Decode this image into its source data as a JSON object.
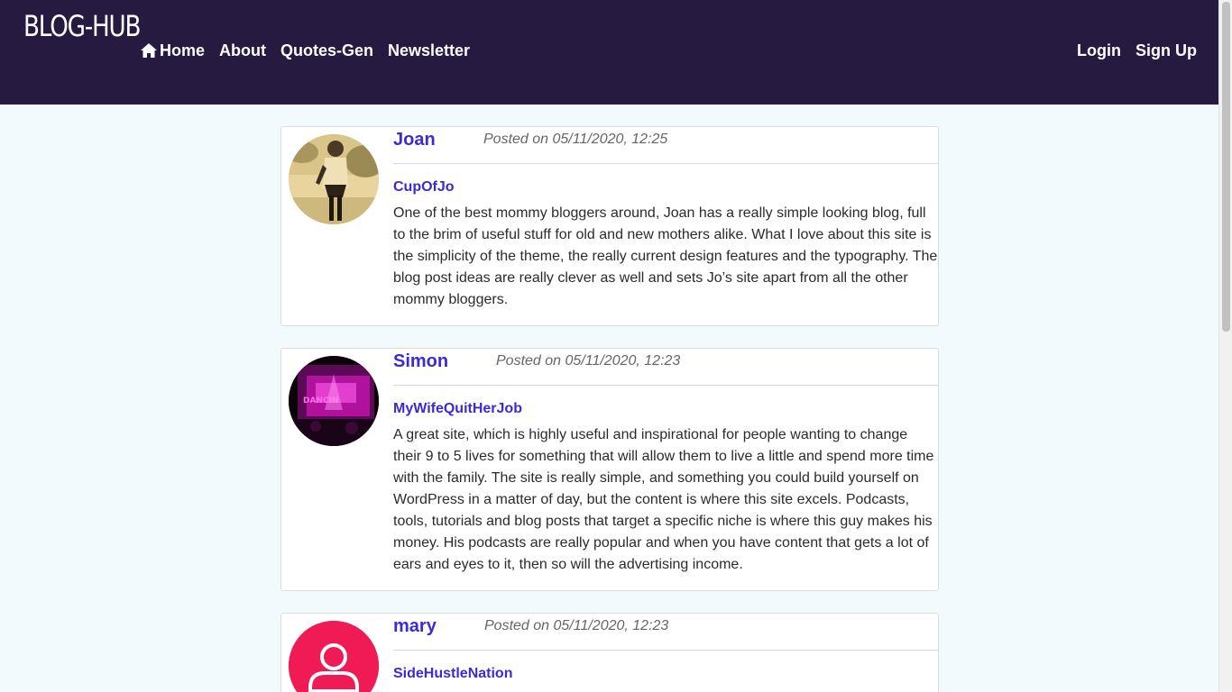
{
  "nav": {
    "brand": "BLOG-HUB",
    "home_icon": "home-icon",
    "links": [
      "Home",
      "About",
      "Quotes-Gen",
      "Newsletter"
    ],
    "right_links": [
      "Login",
      "Sign Up"
    ]
  },
  "posts": [
    {
      "author": "Joan",
      "posted": "Posted on 05/11/2020, 12:25",
      "blog": "CupOfJo",
      "text": "One of the best mommy bloggers around, Joan has a really simple looking blog, full to the brim of useful stuff for old and new mothers alike. What I love about this site is the simplicity of the theme, the really current design features and the typography. The blog post ideas are really clever as well and sets Jo’s site apart from all the other mommy bloggers."
    },
    {
      "author": "Simon",
      "posted": "Posted on 05/11/2020, 12:23",
      "blog": "MyWifeQuitHerJob",
      "text": "A great site, which is highly useful and inspirational for people wanting to change their 9 to 5 lives for something that will allow them to live a little and spend more time with the family. The site is really simple, and something you could build yourself on WordPress in a matter of day, but the content is where this site excels. Podcasts, tools, tutorials and blog posts that target a specific niche is where this guy makes his money. His podcasts are really popular and when you have content that gets a lot of ears and eyes to it, then so will the advertising income."
    },
    {
      "author": "mary",
      "posted": "Posted on 05/11/2020, 12:23",
      "blog": "SideHustleNation",
      "text": ""
    }
  ],
  "colors": {
    "navbar": "#261a40",
    "accent": "#3d2ad1",
    "avatar_pink": "#f01a55"
  }
}
